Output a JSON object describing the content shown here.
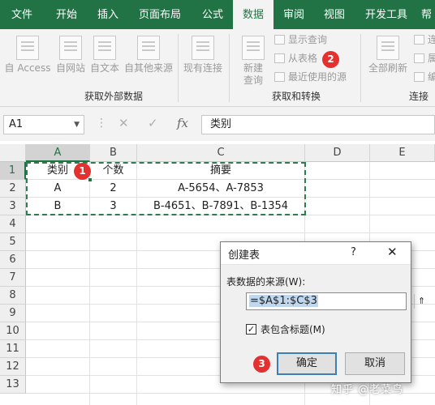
{
  "ribbon_tabs": [
    "文件",
    "开始",
    "插入",
    "页面布局",
    "公式",
    "数据",
    "审阅",
    "视图",
    "开发工具",
    "帮"
  ],
  "active_tab": "数据",
  "ribbon": {
    "external": {
      "group_label": "获取外部数据",
      "buttons": [
        "自 Access",
        "自网站",
        "自文本",
        "自其他来源",
        "现有连接"
      ]
    },
    "transform": {
      "group_label": "获取和转换",
      "new_query": "新建",
      "new_query_line2": "查询",
      "show_queries": "显示查询",
      "from_table": "从表格",
      "recent_sources": "最近使用的源"
    },
    "connections": {
      "group_label": "连接",
      "refresh_all": "全部刷新",
      "item1": "连",
      "item2": "属",
      "item3": "编"
    }
  },
  "formula_bar": {
    "name_box": "A1",
    "cancel_symbol": "✕",
    "enter_symbol": "✓",
    "fx_symbol": "fx",
    "formula": "类别"
  },
  "sheet": {
    "columns": [
      "A",
      "B",
      "C",
      "D",
      "E"
    ],
    "rows": [
      "1",
      "2",
      "3",
      "4",
      "5",
      "6",
      "7",
      "8",
      "9",
      "10",
      "11",
      "12",
      "13"
    ],
    "cells": [
      [
        "类别",
        "个数",
        "摘要"
      ],
      [
        "A",
        "2",
        "A-5654、A-7853"
      ],
      [
        "B",
        "3",
        "B-4651、B-7891、B-1354"
      ]
    ]
  },
  "dialog": {
    "title": "创建表",
    "help_symbol": "?",
    "close_symbol": "✕",
    "source_label": "表数据的来源(W):",
    "range_value": "=$A$1:$C$3",
    "collapse_symbol": "⇑",
    "header_checkbox_label": "表包含标题(M)",
    "header_checked": "✓",
    "ok_label": "确定",
    "cancel_label": "取消"
  },
  "badges": [
    "1",
    "2",
    "3"
  ],
  "watermark": "知乎 @老菜鸟",
  "colors": {
    "excel_green": "#217346",
    "badge_red": "#e53030",
    "marquee_green": "#2e7d4f"
  }
}
